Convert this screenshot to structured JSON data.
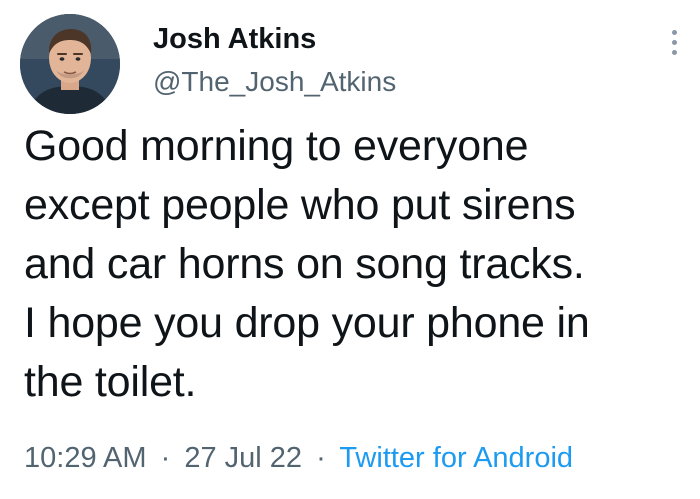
{
  "user": {
    "display_name": "Josh Atkins",
    "handle": "@The_Josh_Atkins"
  },
  "tweet": {
    "lines": [
      "Good morning to everyone",
      "except people who put sirens",
      "and car horns on song tracks.",
      "I hope you drop your phone in",
      "the toilet."
    ]
  },
  "meta": {
    "time": "10:29 AM",
    "separator": "·",
    "date": "27 Jul 22",
    "source": "Twitter for Android"
  },
  "colors": {
    "text": "#0f1419",
    "secondary": "#536471",
    "link": "#1d9bf0"
  },
  "icons": {
    "more": "vertical-ellipsis-icon"
  }
}
